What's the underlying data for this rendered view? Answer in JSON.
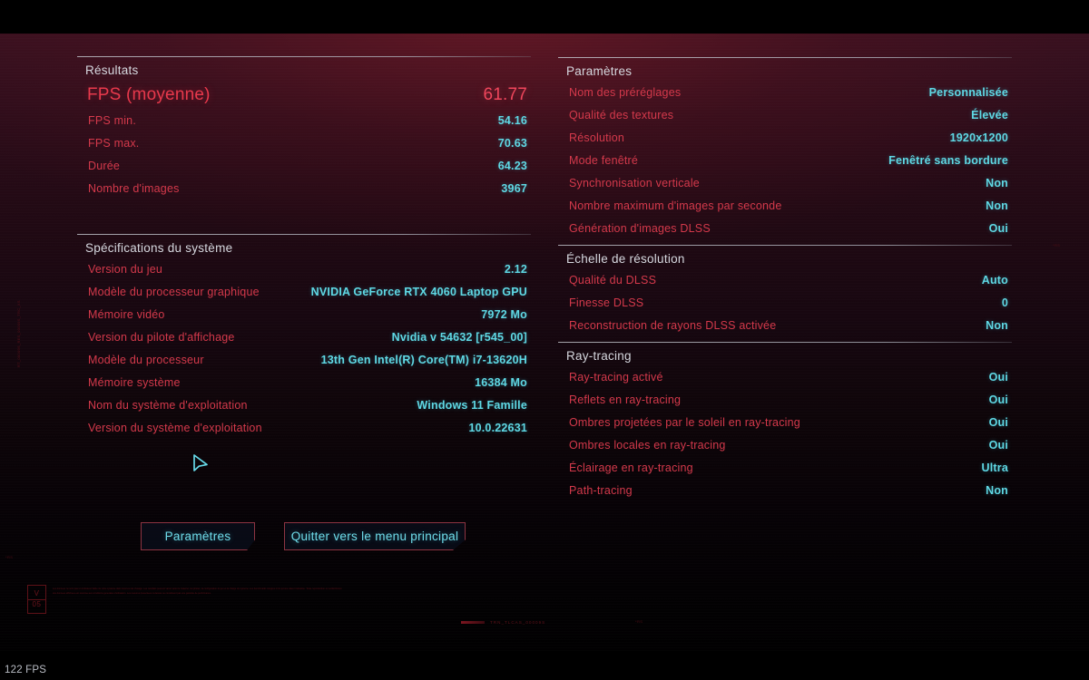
{
  "hud": {
    "fps_counter": "122 FPS",
    "version_box_top": "V",
    "version_box_bottom": "05",
    "micro_legal": "Les donnees ne sont pas un indicateur fiable de votre systeme dans tous les cas d'usage. Les resultats peuvent varier selon le materiel, les pilotes, la configuration du jeu et la charge du systeme. Les benchmarks integres n'ont qu'une valeur indicative. Toute reproduction ou redistribution des donnees affichees est soumise aux conditions generales d'utilisation. Les mesures presentees ci-dessus ne constituent pas une garantie de performance.",
    "side_micro": "RT_00009S_RES_00009S_TRC_XS",
    "tagline": "TRN_TLCAS_00009S",
    "blip_right": "*RS",
    "blip_mid": "*RS",
    "blip_left": "*RS"
  },
  "cursor": {
    "icon": "mouse-pointer-icon",
    "color": "#66d9e8"
  },
  "colors": {
    "key": "#d4394b",
    "value": "#5fd8e4",
    "hero": "#f0465c",
    "section_title": "#d6d8df",
    "button_border": "#8d3442",
    "button_text": "#6fdcea"
  },
  "left_column": {
    "sections": [
      {
        "title": "Résultats",
        "rows": [
          {
            "label": "FPS (moyenne)",
            "value": "61.77",
            "hero": true
          },
          {
            "label": "FPS min.",
            "value": "54.16"
          },
          {
            "label": "FPS max.",
            "value": "70.63"
          },
          {
            "label": "Durée",
            "value": "64.23"
          },
          {
            "label": "Nombre d'images",
            "value": "3967"
          }
        ]
      },
      {
        "title": "Spécifications du système",
        "rows": [
          {
            "label": "Version du jeu",
            "value": "2.12"
          },
          {
            "label": "Modèle du processeur graphique",
            "value": "NVIDIA GeForce RTX 4060 Laptop GPU"
          },
          {
            "label": "Mémoire vidéo",
            "value": "7972 Mo"
          },
          {
            "label": "Version du pilote d'affichage",
            "value": "Nvidia v 54632 [r545_00]"
          },
          {
            "label": "Modèle du processeur",
            "value": "13th Gen Intel(R) Core(TM) i7-13620H"
          },
          {
            "label": "Mémoire système",
            "value": "16384 Mo"
          },
          {
            "label": "Nom du système d'exploitation",
            "value": "Windows 11 Famille"
          },
          {
            "label": "Version du système d'exploitation",
            "value": "10.0.22631"
          }
        ]
      }
    ]
  },
  "right_column": {
    "sections": [
      {
        "title": "Paramètres",
        "rows": [
          {
            "label": "Nom des préréglages",
            "value": "Personnalisée"
          },
          {
            "label": "Qualité des textures",
            "value": "Élevée"
          },
          {
            "label": "Résolution",
            "value": "1920x1200"
          },
          {
            "label": "Mode fenêtré",
            "value": "Fenêtré sans bordure"
          },
          {
            "label": "Synchronisation verticale",
            "value": "Non"
          },
          {
            "label": "Nombre maximum d'images par seconde",
            "value": "Non"
          },
          {
            "label": "Génération d'images DLSS",
            "value": "Oui"
          }
        ]
      },
      {
        "title": "Échelle de résolution",
        "rows": [
          {
            "label": "Qualité du DLSS",
            "value": "Auto"
          },
          {
            "label": "Finesse DLSS",
            "value": "0"
          },
          {
            "label": "Reconstruction de rayons DLSS activée",
            "value": "Non"
          }
        ]
      },
      {
        "title": "Ray-tracing",
        "rows": [
          {
            "label": "Ray-tracing activé",
            "value": "Oui"
          },
          {
            "label": "Reflets en ray-tracing",
            "value": "Oui"
          },
          {
            "label": "Ombres projetées par le soleil en ray-tracing",
            "value": "Oui"
          },
          {
            "label": "Ombres locales en ray-tracing",
            "value": "Oui"
          },
          {
            "label": "Éclairage en ray-tracing",
            "value": "Ultra"
          },
          {
            "label": "Path-tracing",
            "value": "Non"
          }
        ]
      }
    ]
  },
  "buttons": [
    {
      "id": "settings",
      "label": "Paramètres"
    },
    {
      "id": "quit",
      "label": "Quitter vers le menu principal"
    }
  ]
}
